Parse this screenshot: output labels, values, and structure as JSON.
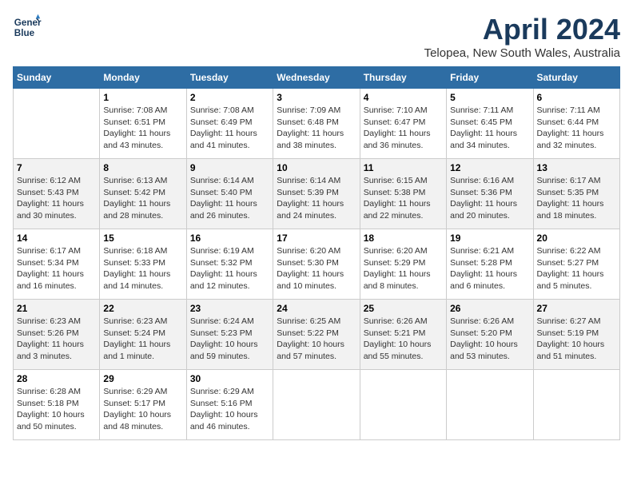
{
  "logo": {
    "line1": "General",
    "line2": "Blue"
  },
  "title": "April 2024",
  "location": "Telopea, New South Wales, Australia",
  "weekdays": [
    "Sunday",
    "Monday",
    "Tuesday",
    "Wednesday",
    "Thursday",
    "Friday",
    "Saturday"
  ],
  "weeks": [
    [
      {
        "day": "",
        "sunrise": "",
        "sunset": "",
        "daylight": ""
      },
      {
        "day": "1",
        "sunrise": "Sunrise: 7:08 AM",
        "sunset": "Sunset: 6:51 PM",
        "daylight": "Daylight: 11 hours and 43 minutes."
      },
      {
        "day": "2",
        "sunrise": "Sunrise: 7:08 AM",
        "sunset": "Sunset: 6:49 PM",
        "daylight": "Daylight: 11 hours and 41 minutes."
      },
      {
        "day": "3",
        "sunrise": "Sunrise: 7:09 AM",
        "sunset": "Sunset: 6:48 PM",
        "daylight": "Daylight: 11 hours and 38 minutes."
      },
      {
        "day": "4",
        "sunrise": "Sunrise: 7:10 AM",
        "sunset": "Sunset: 6:47 PM",
        "daylight": "Daylight: 11 hours and 36 minutes."
      },
      {
        "day": "5",
        "sunrise": "Sunrise: 7:11 AM",
        "sunset": "Sunset: 6:45 PM",
        "daylight": "Daylight: 11 hours and 34 minutes."
      },
      {
        "day": "6",
        "sunrise": "Sunrise: 7:11 AM",
        "sunset": "Sunset: 6:44 PM",
        "daylight": "Daylight: 11 hours and 32 minutes."
      }
    ],
    [
      {
        "day": "7",
        "sunrise": "Sunrise: 6:12 AM",
        "sunset": "Sunset: 5:43 PM",
        "daylight": "Daylight: 11 hours and 30 minutes."
      },
      {
        "day": "8",
        "sunrise": "Sunrise: 6:13 AM",
        "sunset": "Sunset: 5:42 PM",
        "daylight": "Daylight: 11 hours and 28 minutes."
      },
      {
        "day": "9",
        "sunrise": "Sunrise: 6:14 AM",
        "sunset": "Sunset: 5:40 PM",
        "daylight": "Daylight: 11 hours and 26 minutes."
      },
      {
        "day": "10",
        "sunrise": "Sunrise: 6:14 AM",
        "sunset": "Sunset: 5:39 PM",
        "daylight": "Daylight: 11 hours and 24 minutes."
      },
      {
        "day": "11",
        "sunrise": "Sunrise: 6:15 AM",
        "sunset": "Sunset: 5:38 PM",
        "daylight": "Daylight: 11 hours and 22 minutes."
      },
      {
        "day": "12",
        "sunrise": "Sunrise: 6:16 AM",
        "sunset": "Sunset: 5:36 PM",
        "daylight": "Daylight: 11 hours and 20 minutes."
      },
      {
        "day": "13",
        "sunrise": "Sunrise: 6:17 AM",
        "sunset": "Sunset: 5:35 PM",
        "daylight": "Daylight: 11 hours and 18 minutes."
      }
    ],
    [
      {
        "day": "14",
        "sunrise": "Sunrise: 6:17 AM",
        "sunset": "Sunset: 5:34 PM",
        "daylight": "Daylight: 11 hours and 16 minutes."
      },
      {
        "day": "15",
        "sunrise": "Sunrise: 6:18 AM",
        "sunset": "Sunset: 5:33 PM",
        "daylight": "Daylight: 11 hours and 14 minutes."
      },
      {
        "day": "16",
        "sunrise": "Sunrise: 6:19 AM",
        "sunset": "Sunset: 5:32 PM",
        "daylight": "Daylight: 11 hours and 12 minutes."
      },
      {
        "day": "17",
        "sunrise": "Sunrise: 6:20 AM",
        "sunset": "Sunset: 5:30 PM",
        "daylight": "Daylight: 11 hours and 10 minutes."
      },
      {
        "day": "18",
        "sunrise": "Sunrise: 6:20 AM",
        "sunset": "Sunset: 5:29 PM",
        "daylight": "Daylight: 11 hours and 8 minutes."
      },
      {
        "day": "19",
        "sunrise": "Sunrise: 6:21 AM",
        "sunset": "Sunset: 5:28 PM",
        "daylight": "Daylight: 11 hours and 6 minutes."
      },
      {
        "day": "20",
        "sunrise": "Sunrise: 6:22 AM",
        "sunset": "Sunset: 5:27 PM",
        "daylight": "Daylight: 11 hours and 5 minutes."
      }
    ],
    [
      {
        "day": "21",
        "sunrise": "Sunrise: 6:23 AM",
        "sunset": "Sunset: 5:26 PM",
        "daylight": "Daylight: 11 hours and 3 minutes."
      },
      {
        "day": "22",
        "sunrise": "Sunrise: 6:23 AM",
        "sunset": "Sunset: 5:24 PM",
        "daylight": "Daylight: 11 hours and 1 minute."
      },
      {
        "day": "23",
        "sunrise": "Sunrise: 6:24 AM",
        "sunset": "Sunset: 5:23 PM",
        "daylight": "Daylight: 10 hours and 59 minutes."
      },
      {
        "day": "24",
        "sunrise": "Sunrise: 6:25 AM",
        "sunset": "Sunset: 5:22 PM",
        "daylight": "Daylight: 10 hours and 57 minutes."
      },
      {
        "day": "25",
        "sunrise": "Sunrise: 6:26 AM",
        "sunset": "Sunset: 5:21 PM",
        "daylight": "Daylight: 10 hours and 55 minutes."
      },
      {
        "day": "26",
        "sunrise": "Sunrise: 6:26 AM",
        "sunset": "Sunset: 5:20 PM",
        "daylight": "Daylight: 10 hours and 53 minutes."
      },
      {
        "day": "27",
        "sunrise": "Sunrise: 6:27 AM",
        "sunset": "Sunset: 5:19 PM",
        "daylight": "Daylight: 10 hours and 51 minutes."
      }
    ],
    [
      {
        "day": "28",
        "sunrise": "Sunrise: 6:28 AM",
        "sunset": "Sunset: 5:18 PM",
        "daylight": "Daylight: 10 hours and 50 minutes."
      },
      {
        "day": "29",
        "sunrise": "Sunrise: 6:29 AM",
        "sunset": "Sunset: 5:17 PM",
        "daylight": "Daylight: 10 hours and 48 minutes."
      },
      {
        "day": "30",
        "sunrise": "Sunrise: 6:29 AM",
        "sunset": "Sunset: 5:16 PM",
        "daylight": "Daylight: 10 hours and 46 minutes."
      },
      {
        "day": "",
        "sunrise": "",
        "sunset": "",
        "daylight": ""
      },
      {
        "day": "",
        "sunrise": "",
        "sunset": "",
        "daylight": ""
      },
      {
        "day": "",
        "sunrise": "",
        "sunset": "",
        "daylight": ""
      },
      {
        "day": "",
        "sunrise": "",
        "sunset": "",
        "daylight": ""
      }
    ]
  ]
}
